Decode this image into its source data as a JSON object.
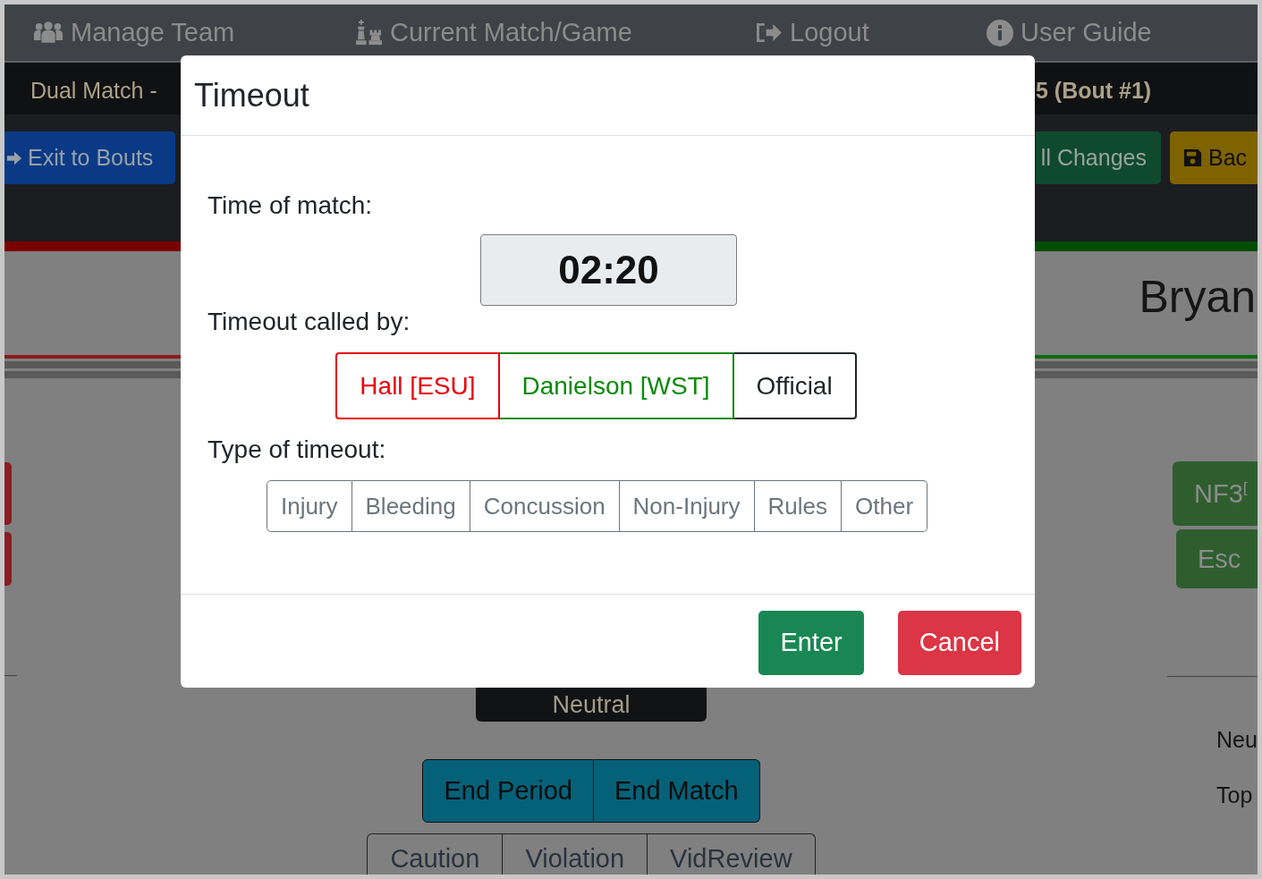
{
  "nav": [
    {
      "label": "Manage Team"
    },
    {
      "label": "Current Match/Game"
    },
    {
      "label": "Logout"
    },
    {
      "label": "User Guide"
    }
  ],
  "match_bar": {
    "title": "Dual Match -",
    "bout": "5 (Bout #1)",
    "exit_button": "Exit to Bouts",
    "changes_button": "ll Changes",
    "back_button": "Bac"
  },
  "scoreboard": {
    "wrestler_name": "Bryan",
    "right_buttons": [
      "NF3$^{[}$",
      "Esc"
    ],
    "right_labels": [
      "Neu",
      "Top"
    ],
    "position": "Neutral",
    "end_buttons": [
      "End Period",
      "End Match"
    ],
    "penalty_buttons": [
      "Caution",
      "Violation",
      "VidReview"
    ]
  },
  "modal": {
    "title": "Timeout",
    "time_label": "Time of match:",
    "time": "02:20",
    "called_by_label": "Timeout called by:",
    "called_by": [
      {
        "label": "Hall [ESU]",
        "color": "#e8000b",
        "selected": false
      },
      {
        "label": "Danielson [WST]",
        "color": "#0a8a0a",
        "selected": false
      },
      {
        "label": "Official",
        "color": "#212529",
        "selected": false
      }
    ],
    "type_label": "Type of timeout:",
    "types": [
      {
        "label": "Injury",
        "selected": false
      },
      {
        "label": "Bleeding",
        "selected": false
      },
      {
        "label": "Concussion",
        "selected": false
      },
      {
        "label": "Non-Injury",
        "selected": false
      },
      {
        "label": "Rules",
        "selected": false
      },
      {
        "label": "Other",
        "selected": false
      }
    ],
    "buttons": [
      {
        "label": "Enter",
        "kind": "primary"
      },
      {
        "label": "Cancel",
        "kind": "danger"
      }
    ]
  }
}
